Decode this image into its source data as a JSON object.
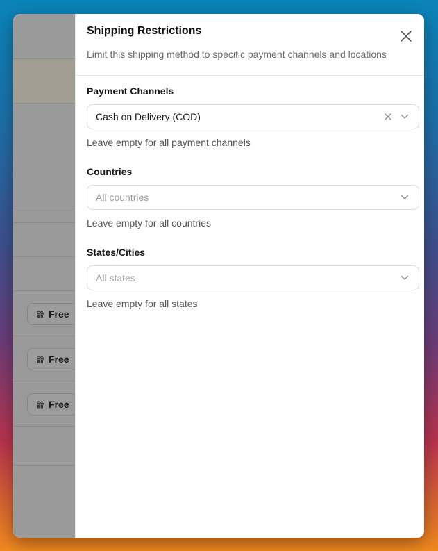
{
  "background": {
    "free_pills": [
      {
        "label": "Free",
        "icon": "gift-icon"
      },
      {
        "label": "Free",
        "icon": "gift-icon"
      },
      {
        "label": "Free",
        "icon": "gift-icon"
      }
    ]
  },
  "drawer": {
    "title": "Shipping Restrictions",
    "subtitle": "Limit this shipping method to specific payment channels and locations",
    "close_icon": "close-icon"
  },
  "fields": {
    "payment_channels": {
      "label": "Payment Channels",
      "value": "Cash on Delivery (COD)",
      "help": "Leave empty for all payment channels"
    },
    "countries": {
      "label": "Countries",
      "placeholder": "All countries",
      "help": "Leave empty for all countries"
    },
    "states": {
      "label": "States/Cities",
      "placeholder": "All states",
      "help": "Leave empty for all states"
    }
  },
  "colors": {
    "overlay": "#9a9a9a",
    "border": "#dcdcdc",
    "title": "#111111",
    "muted": "#6b6b6b"
  }
}
